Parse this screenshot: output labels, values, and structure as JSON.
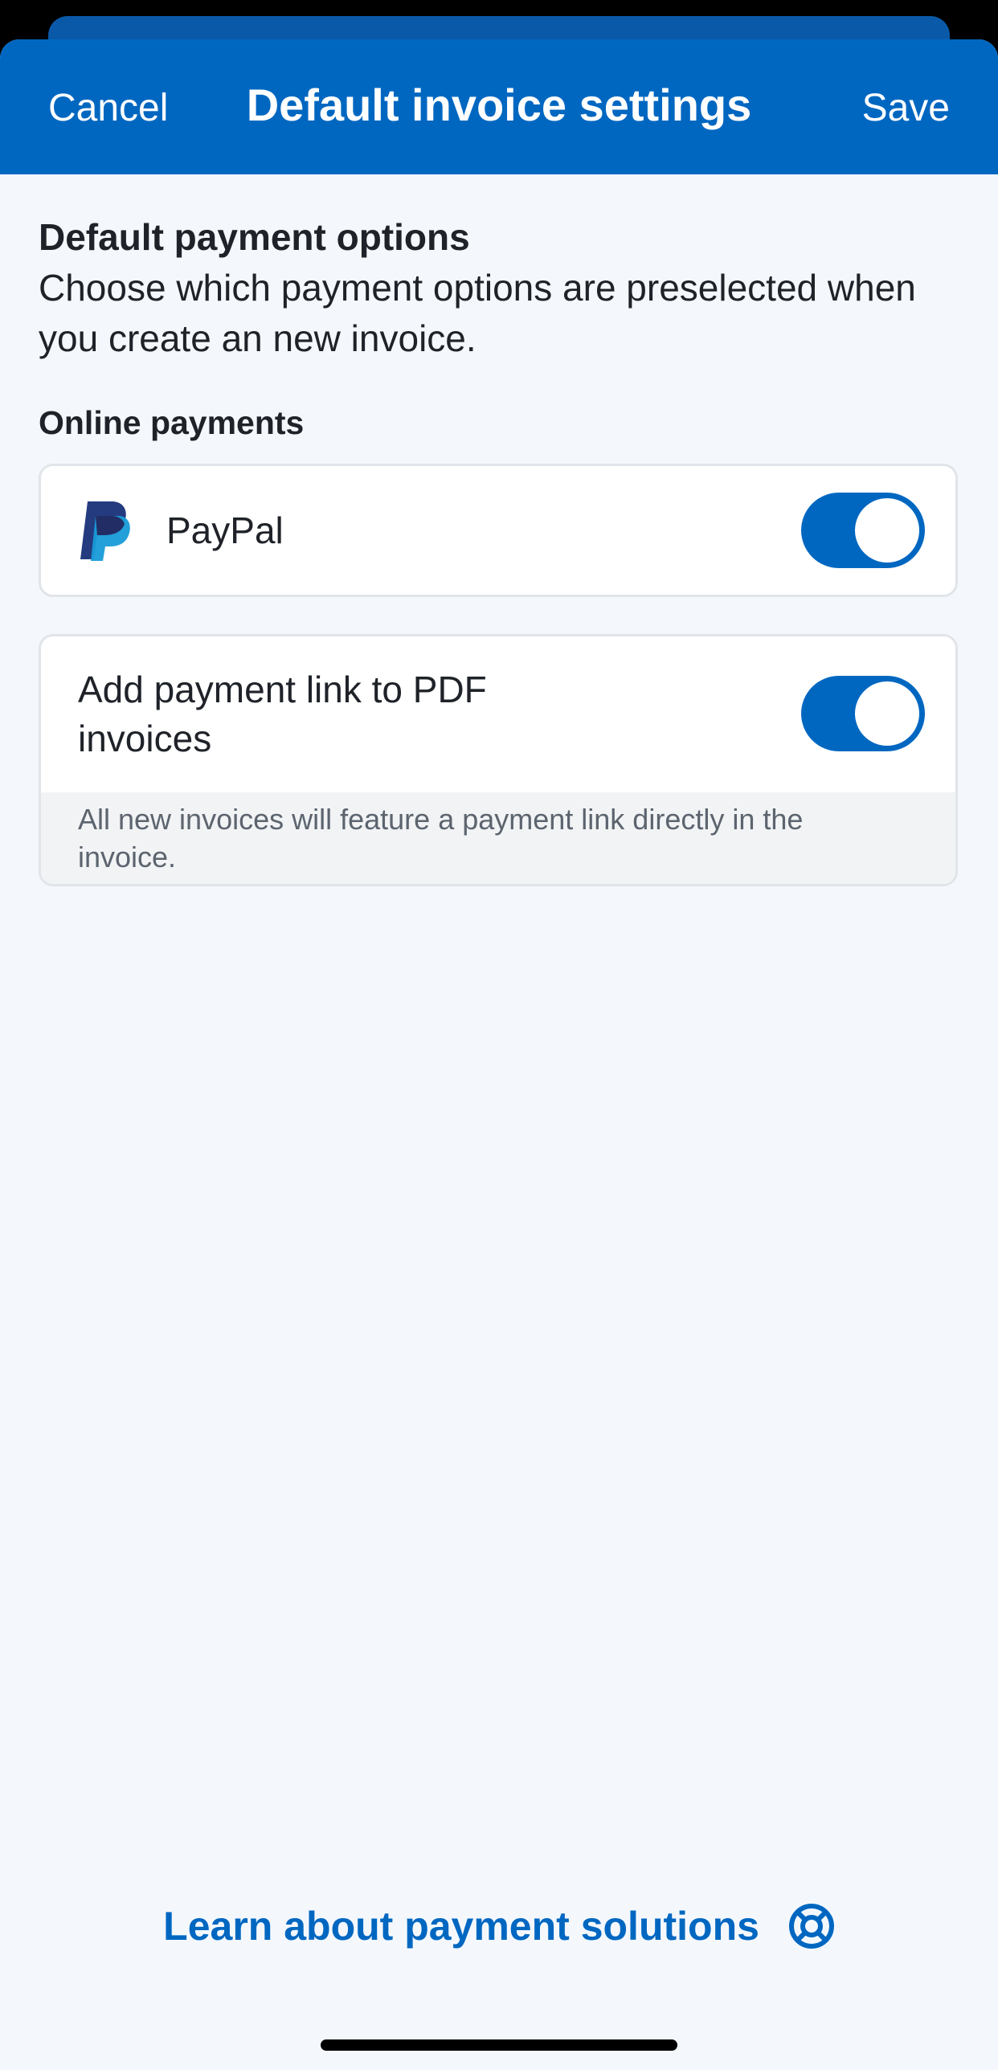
{
  "navbar": {
    "cancel_label": "Cancel",
    "title": "Default invoice settings",
    "save_label": "Save"
  },
  "section": {
    "title": "Default payment options",
    "description": "Choose which payment options are preselected when you create an new invoice."
  },
  "online_payments": {
    "label": "Online payments",
    "paypal": {
      "icon": "paypal-logo",
      "label": "PayPal",
      "enabled": true
    }
  },
  "payment_link": {
    "label": "Add payment link to PDF invoices",
    "enabled": true,
    "note": "All new invoices will feature a payment link directly in the invoice."
  },
  "footer": {
    "learn_label": "Learn about payment solutions",
    "icon": "lifebuoy-icon"
  },
  "colors": {
    "primary": "#0067c1",
    "background": "#f4f8fd",
    "text": "#1f2329",
    "muted_text": "#5c646e",
    "paypal_dark": "#253b80",
    "paypal_light": "#179bd7"
  }
}
